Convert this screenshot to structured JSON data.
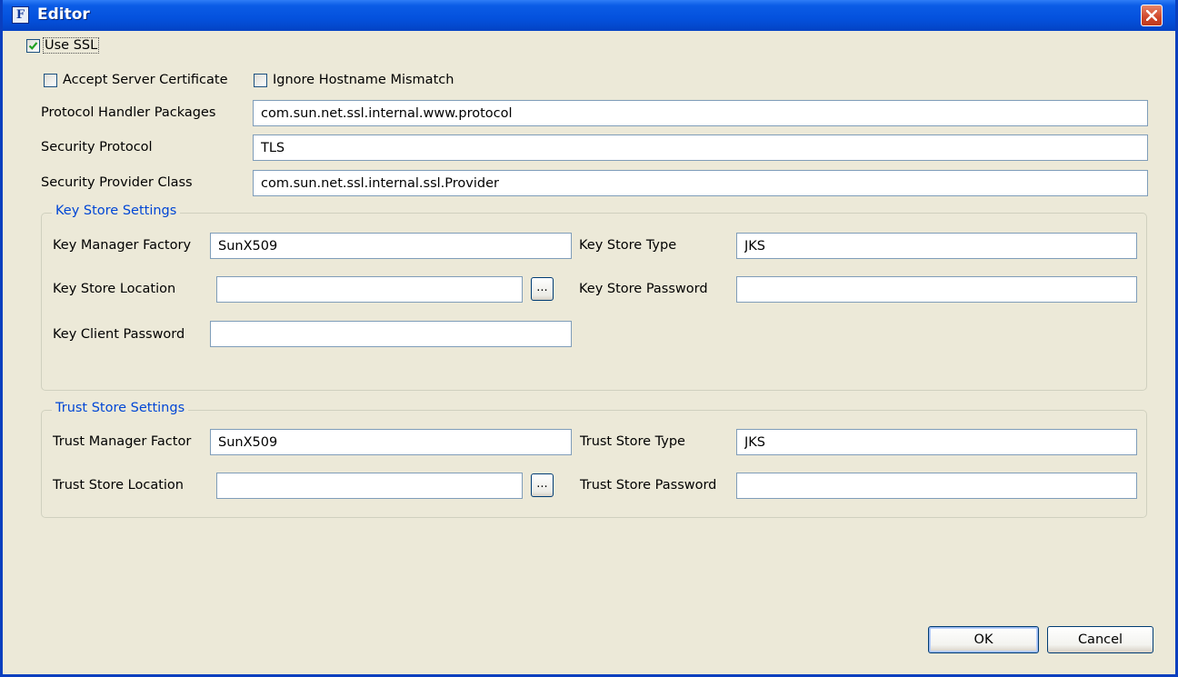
{
  "window": {
    "title": "Editor",
    "icon": "app-icon",
    "close": "close-icon"
  },
  "use_ssl": {
    "label": "Use SSL",
    "checked": true
  },
  "accept_server_certificate": {
    "label": "Accept Server Certificate",
    "checked": false
  },
  "ignore_hostname_mismatch": {
    "label": "Ignore Hostname Mismatch",
    "checked": false
  },
  "protocol_handler_packages": {
    "label": "Protocol Handler Packages",
    "value": "com.sun.net.ssl.internal.www.protocol"
  },
  "security_protocol": {
    "label": "Security Protocol",
    "value": "TLS"
  },
  "security_provider_class": {
    "label": "Security Provider Class",
    "value": "com.sun.net.ssl.internal.ssl.Provider"
  },
  "key_store": {
    "title": "Key Store Settings",
    "manager_factory": {
      "label": "Key Manager Factory",
      "value": "SunX509"
    },
    "type": {
      "label": "Key Store Type",
      "value": "JKS"
    },
    "location": {
      "label": "Key Store Location",
      "value": "",
      "browse_label": "..."
    },
    "password": {
      "label": "Key Store Password",
      "value": ""
    },
    "client_password": {
      "label": "Key Client Password",
      "value": ""
    }
  },
  "trust_store": {
    "title": "Trust Store Settings",
    "manager_factory": {
      "label": "Trust Manager Factor",
      "value": "SunX509"
    },
    "type": {
      "label": "Trust Store Type",
      "value": "JKS"
    },
    "location": {
      "label": "Trust Store Location",
      "value": "",
      "browse_label": "..."
    },
    "password": {
      "label": "Trust Store Password",
      "value": ""
    }
  },
  "buttons": {
    "ok": "OK",
    "cancel": "Cancel"
  }
}
